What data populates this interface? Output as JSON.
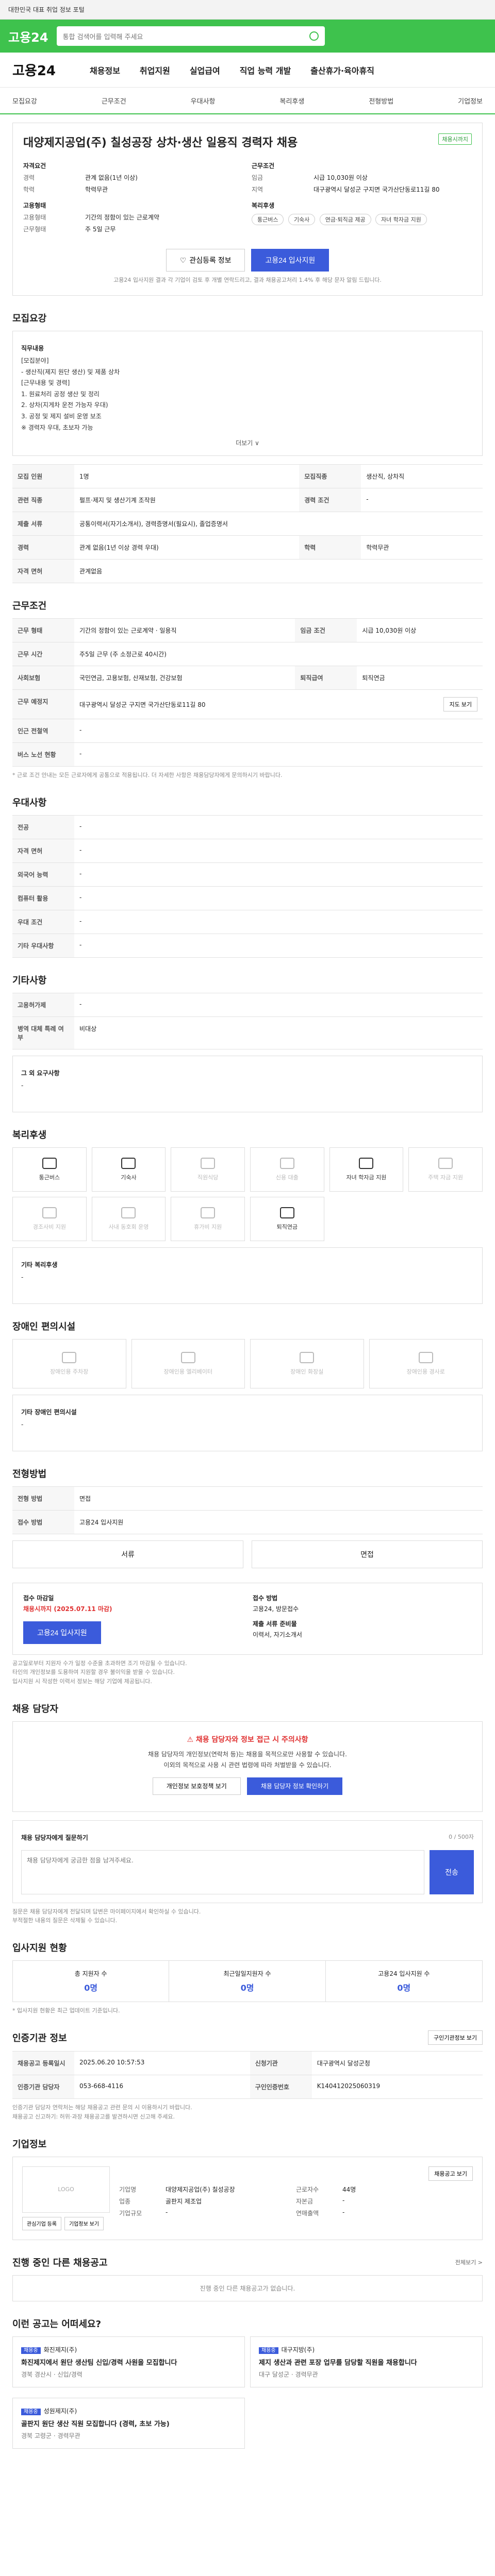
{
  "topbar": {
    "text": "대한민국 대표 취업 정보 포털"
  },
  "brand": {
    "logo": "고용24",
    "search_placeholder": "통합 검색어를 입력해 주세요"
  },
  "gnb": {
    "logo": "고용24",
    "items": [
      "채용정보",
      "취업지원",
      "실업급여",
      "직업 능력 개발",
      "출산휴가·육아휴직"
    ]
  },
  "subnav": {
    "items": [
      "모집요강",
      "근무조건",
      "우대사항",
      "복리후생",
      "전형방법",
      "기업정보"
    ]
  },
  "job": {
    "title": "대양제지공업(주) 칠성공장 상차·생산 일용직 경력자 채용",
    "badge": "채용시까지",
    "left_label": "자격요건",
    "exp_k": "경력",
    "exp_v": "관계 없음(1년 이상)",
    "edu_k": "학력",
    "edu_v": "학력무관",
    "cond_label": "근무조건",
    "wage_k": "임금",
    "wage_v": "시급 10,030원 이상",
    "loc_k": "지역",
    "loc_v": "대구광역시 달성군 구지면 국가산단동로11길 80",
    "type_label": "고용형태",
    "type_k": "고용형태",
    "type_v": "기간의 정함이 있는 근로계약",
    "shift_k": "근무형태",
    "shift_v": "주 5일 근무",
    "welfare_label": "복리후생",
    "welfare_chips": [
      "통근버스",
      "기숙사",
      "연금·퇴직금 제공",
      "자녀 학자금 지원"
    ]
  },
  "actions": {
    "interest": "관심등록 정보",
    "apply": "고용24 입사지원"
  },
  "notice": "고용24 입사지원 결과 각 기업이 검토 후 개별 연락드리고, 결과 채용공고처리 1.4% 후 해당 문자 알림 드립니다.",
  "recruit": {
    "heading": "모집요강",
    "job_label": "직무내용",
    "job_lines": [
      "[모집분야]",
      "- 생산직(제지 원단 생산) 및 제품 상차",
      "",
      "[근무내용 및 경력]",
      "1. 원료처리 공정 생산 및 정리",
      "2. 상차(지게차 운전 가능자 우대)",
      "3. 공정 및 제지 설비 운영 보조",
      "",
      "※ 경력자 우대, 초보자 가능"
    ],
    "more": "더보기 ∨",
    "rows": [
      [
        "모집 인원",
        "1명",
        "모집직종",
        "생산직, 상차직"
      ],
      [
        "관련 직종",
        "펄프·제지 및 생산기계 조작원",
        "경력 조건",
        "-"
      ],
      [
        "제출 서류",
        "공통이력서(자기소개서), 경력증명서(필요시), 졸업증명서",
        "",
        ""
      ],
      [
        "경력",
        "관계 없음(1년 이상 경력 우대)",
        "학력",
        "학력무관"
      ],
      [
        "자격 면허",
        "관계없음",
        "",
        ""
      ]
    ]
  },
  "work": {
    "heading": "근무조건",
    "rows": [
      [
        "근무 형태",
        "기간의 정함이 있는 근로계약 · 일용직",
        "임금 조건",
        "시급 10,030원 이상"
      ],
      [
        "근무 시간",
        "주5일 근무 (주 소정근로 40시간)",
        "",
        ""
      ],
      [
        "사회보험",
        "국민연금, 고용보험, 산재보험, 건강보험",
        "퇴직급여",
        "퇴직연금"
      ],
      [
        "근무 예정지",
        "대구광역시 달성군 구지면 국가산단동로11길 80",
        "",
        ""
      ],
      [
        "인근 전철역",
        "-",
        "",
        ""
      ],
      [
        "버스 노선 현황",
        "-",
        "",
        ""
      ]
    ],
    "note": "* 근로 조건 안내는 모든 근로자에게 공통으로 적용됩니다. 더 자세한 사항은 채용담당자에게 문의하시기 바랍니다.",
    "map_btn": "지도 보기"
  },
  "prefer": {
    "heading": "우대사항",
    "rows": [
      [
        "전공",
        "-"
      ],
      [
        "자격 면허",
        "-"
      ],
      [
        "외국어 능력",
        "-"
      ],
      [
        "컴퓨터 활용",
        "-"
      ],
      [
        "우대 조건",
        "-"
      ],
      [
        "기타 우대사항",
        "-"
      ]
    ]
  },
  "extra": {
    "heading": "기타사항",
    "rows": [
      [
        "고용허가제",
        "-"
      ],
      [
        "병역 대체 특례 여부",
        "비대상"
      ]
    ],
    "sub_label": "그 외 요구사항",
    "sub_value": "-"
  },
  "welfare": {
    "heading": "복리후생",
    "items": [
      {
        "label": "통근버스",
        "on": true
      },
      {
        "label": "기숙사",
        "on": true
      },
      {
        "label": "직원식당",
        "on": false
      },
      {
        "label": "신용 대출",
        "on": false
      },
      {
        "label": "자녀 학자금 지원",
        "on": true
      },
      {
        "label": "주택 자금 지원",
        "on": false
      },
      {
        "label": "경조사비 지원",
        "on": false
      },
      {
        "label": "사내 동호회 운영",
        "on": false
      },
      {
        "label": "휴가비 지원",
        "on": false
      },
      {
        "label": "퇴직연금",
        "on": true
      }
    ],
    "etc_label": "기타 복리후생",
    "etc_value": "-"
  },
  "disability": {
    "heading": "장애인 편의시설",
    "items": [
      "장애인용 주차장",
      "장애인용 엘리베이터",
      "장애인 화장실",
      "장애인용 경사로"
    ],
    "etc_label": "기타 장애인 편의시설",
    "etc_value": "-"
  },
  "selection": {
    "heading": "전형방법",
    "rows": [
      [
        "전형 방법",
        "면접"
      ],
      [
        "접수 방법",
        "고용24 입사지원"
      ]
    ],
    "methods": [
      "서류",
      "면접"
    ]
  },
  "apply": {
    "heading": "채용 담당자",
    "deadline_label": "접수 마감일",
    "deadline_value": "채용시까지 (2025.07.11 마감)",
    "method_label": "접수 방법",
    "method_value": "고용24, 방문접수",
    "doc_label": "제출 서류 준비물",
    "doc_value": "이력서, 자기소개서",
    "btn": "고용24 입사지원",
    "notes": [
      "공고일로부터 지원자 수가 일정 수준을 초과하면 조기 마감될 수 있습니다.",
      "타인의 개인정보를 도용하여 지원할 경우 불이익을 받을 수 있습니다.",
      "입사지원 시 작성한 이력서 정보는 해당 기업에 제공됩니다."
    ]
  },
  "manager": {
    "heading": "채용 담당자",
    "warn": "채용 담당자와 정보 접근 시 주의사항",
    "text1": "채용 담당자의 개인정보(연락처 등)는 채용을 목적으로만 사용할 수 있습니다.",
    "text2": "이외의 목적으로 사용 시 관련 법령에 따라 처벌받을 수 있습니다.",
    "btn1": "개인정보 보호정책 보기",
    "btn2": "채용 담당자 정보 확인하기",
    "ask_label": "채용 담당자에게 질문하기",
    "ask_placeholder": "채용 담당자에게 궁금한 점을 남겨주세요.",
    "ask_btn": "전송",
    "ask_count": "0 / 500자",
    "bullets": [
      "질문은 채용 담당자에게 전달되며 답변은 마이페이지에서 확인하실 수 있습니다.",
      "부적절한 내용의 질문은 삭제될 수 있습니다."
    ]
  },
  "stats": {
    "heading": "입사지원 현황",
    "items": [
      {
        "label": "총 지원자 수",
        "value": "0명"
      },
      {
        "label": "최근일일지원자 수",
        "value": "0명"
      },
      {
        "label": "고용24 입사지원 수",
        "value": "0명"
      }
    ],
    "note": "* 입사지원 현황은 최근 업데이트 기준입니다."
  },
  "info": {
    "heading": "인증기관 정보",
    "btn": "구인기관정보 보기",
    "rows": [
      [
        "채용공고 등록일시",
        "2025.06.20 10:57:53",
        "신청기관",
        "대구광역시 달성군청"
      ],
      [
        "인증기관 담당자",
        "053-668-4116",
        "구인인증번호",
        "K140412025060319"
      ]
    ],
    "notes": [
      "인증기관 담당자 연락처는 해당 채용공고 관련 문의 시 이용하시기 바랍니다.",
      "채용공고 신고하기: 허위·과장 채용공고를 발견하시면 신고해 주세요."
    ]
  },
  "company": {
    "heading": "기업정보",
    "logo": "LOGO",
    "name_k": "기업명",
    "name_v": "대양제지공업(주) 칠성공장",
    "ind_k": "업종",
    "ind_v": "골판지 제조업",
    "size_k": "기업규모",
    "size_v": "-",
    "emp_k": "근로자수",
    "emp_v": "44명",
    "cap_k": "자본금",
    "cap_v": "-",
    "sales_k": "연매출액",
    "sales_v": "-",
    "btn": "채용공고 보기",
    "btn2": "관심기업 등록",
    "btn3": "기업정보 보기"
  },
  "others": {
    "heading": "진행 중인 다른 채용공고",
    "empty": "진행 중인 다른 채용공고가 없습니다.",
    "more": "전체보기 >"
  },
  "recommend": {
    "heading": "이런 공고는 어떠세요?",
    "items": [
      {
        "tag": "채용중",
        "company": "화진제지(주)",
        "title": "화진제지에서 원단 생산팀 신입/경력 사원을 모집합니다",
        "meta": "경북 경산시 · 신입/경력"
      },
      {
        "tag": "채용중",
        "company": "대구지방(주)",
        "title": "제지 생산과 관련 포장 업무를 담당할 직원을 채용합니다",
        "meta": "대구 달성군 · 경력무관"
      },
      {
        "tag": "채용중",
        "company": "성원제지(주)",
        "title": "골판지 원단 생산 직원 모집합니다 (경력, 초보 가능)",
        "meta": "경북 고령군 · 경력무관"
      }
    ]
  }
}
